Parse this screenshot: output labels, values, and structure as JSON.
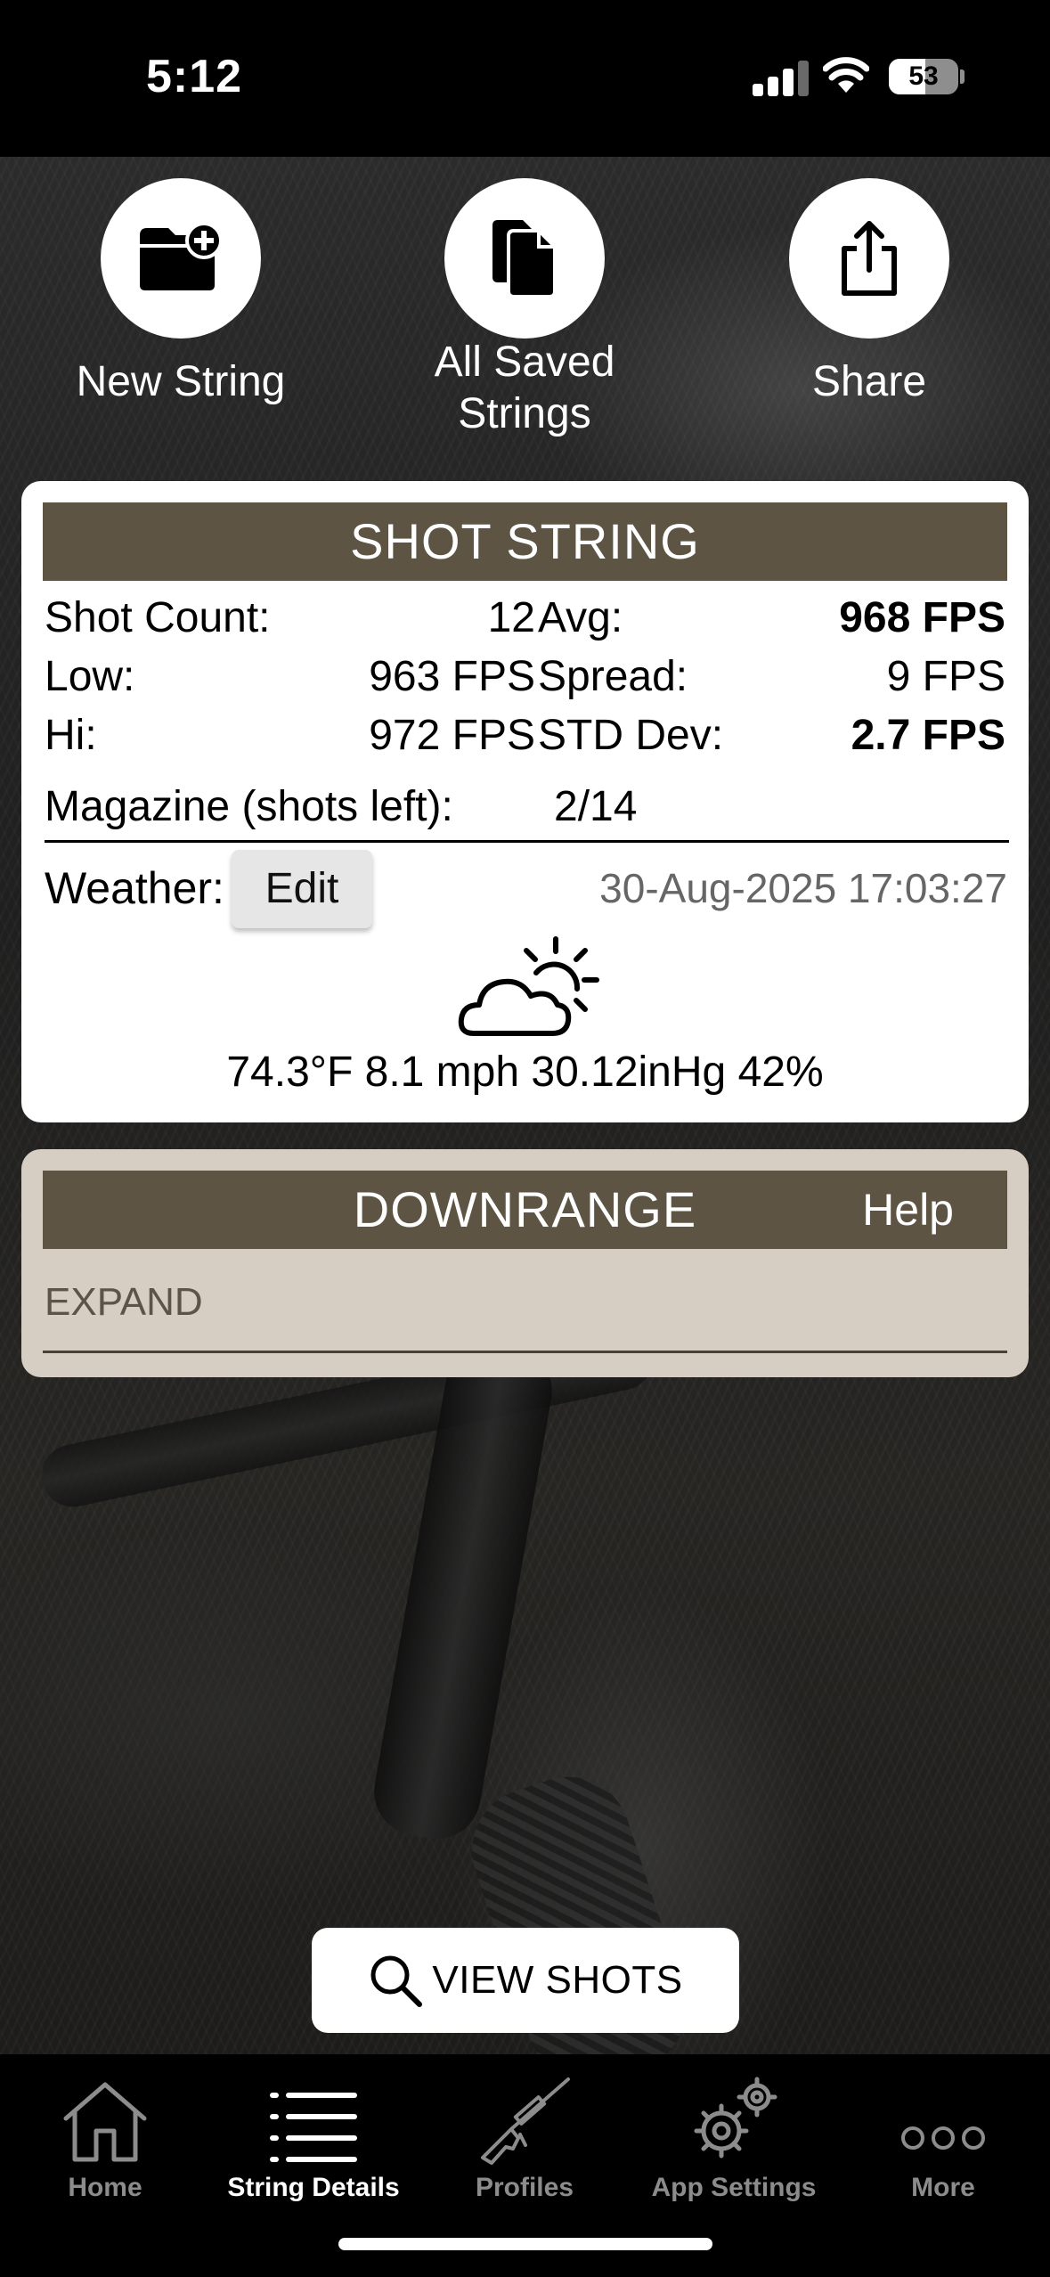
{
  "status_bar": {
    "time": "5:12",
    "battery_percent": "53",
    "battery_level": 0.53,
    "signal_bars": 3
  },
  "actions": [
    {
      "label": "New String",
      "icon": "folder-plus-icon"
    },
    {
      "label": "All Saved\nStrings",
      "icon": "documents-icon"
    },
    {
      "label": "Share",
      "icon": "share-icon"
    }
  ],
  "shot_string": {
    "title": "SHOT STRING",
    "shot_count_label": "Shot Count:",
    "shot_count_value": "12",
    "low_label": "Low:",
    "low_value": "963 FPS",
    "hi_label": "Hi:",
    "hi_value": "972 FPS",
    "avg_label": "Avg:",
    "avg_value": "968 FPS",
    "spread_label": "Spread:",
    "spread_value": "9 FPS",
    "std_label": "STD Dev:",
    "std_value": "2.7 FPS",
    "magazine_label": "Magazine (shots left):",
    "magazine_value": "2/14",
    "weather_label": "Weather:",
    "edit_label": "Edit",
    "datetime": "30-Aug-2025 17:03:27",
    "weather_icon": "partly-cloudy-icon",
    "weather_readout": "74.3°F 8.1 mph 30.12inHg 42%"
  },
  "downrange": {
    "title": "DOWNRANGE",
    "help_label": "Help",
    "expand_label": "EXPAND"
  },
  "view_shots_label": "VIEW SHOTS",
  "tabs": [
    {
      "label": "Home",
      "icon": "home-icon",
      "active": false
    },
    {
      "label": "String Details",
      "icon": "list-icon",
      "active": true
    },
    {
      "label": "Profiles",
      "icon": "rifle-icon",
      "active": false
    },
    {
      "label": "App Settings",
      "icon": "gears-icon",
      "active": false
    },
    {
      "label": "More",
      "icon": "more-icon",
      "active": false
    }
  ],
  "colors": {
    "header_brown": "#5d5443",
    "downrange_bg": "#d6cdc3",
    "tab_inactive": "#8c8c8c"
  }
}
